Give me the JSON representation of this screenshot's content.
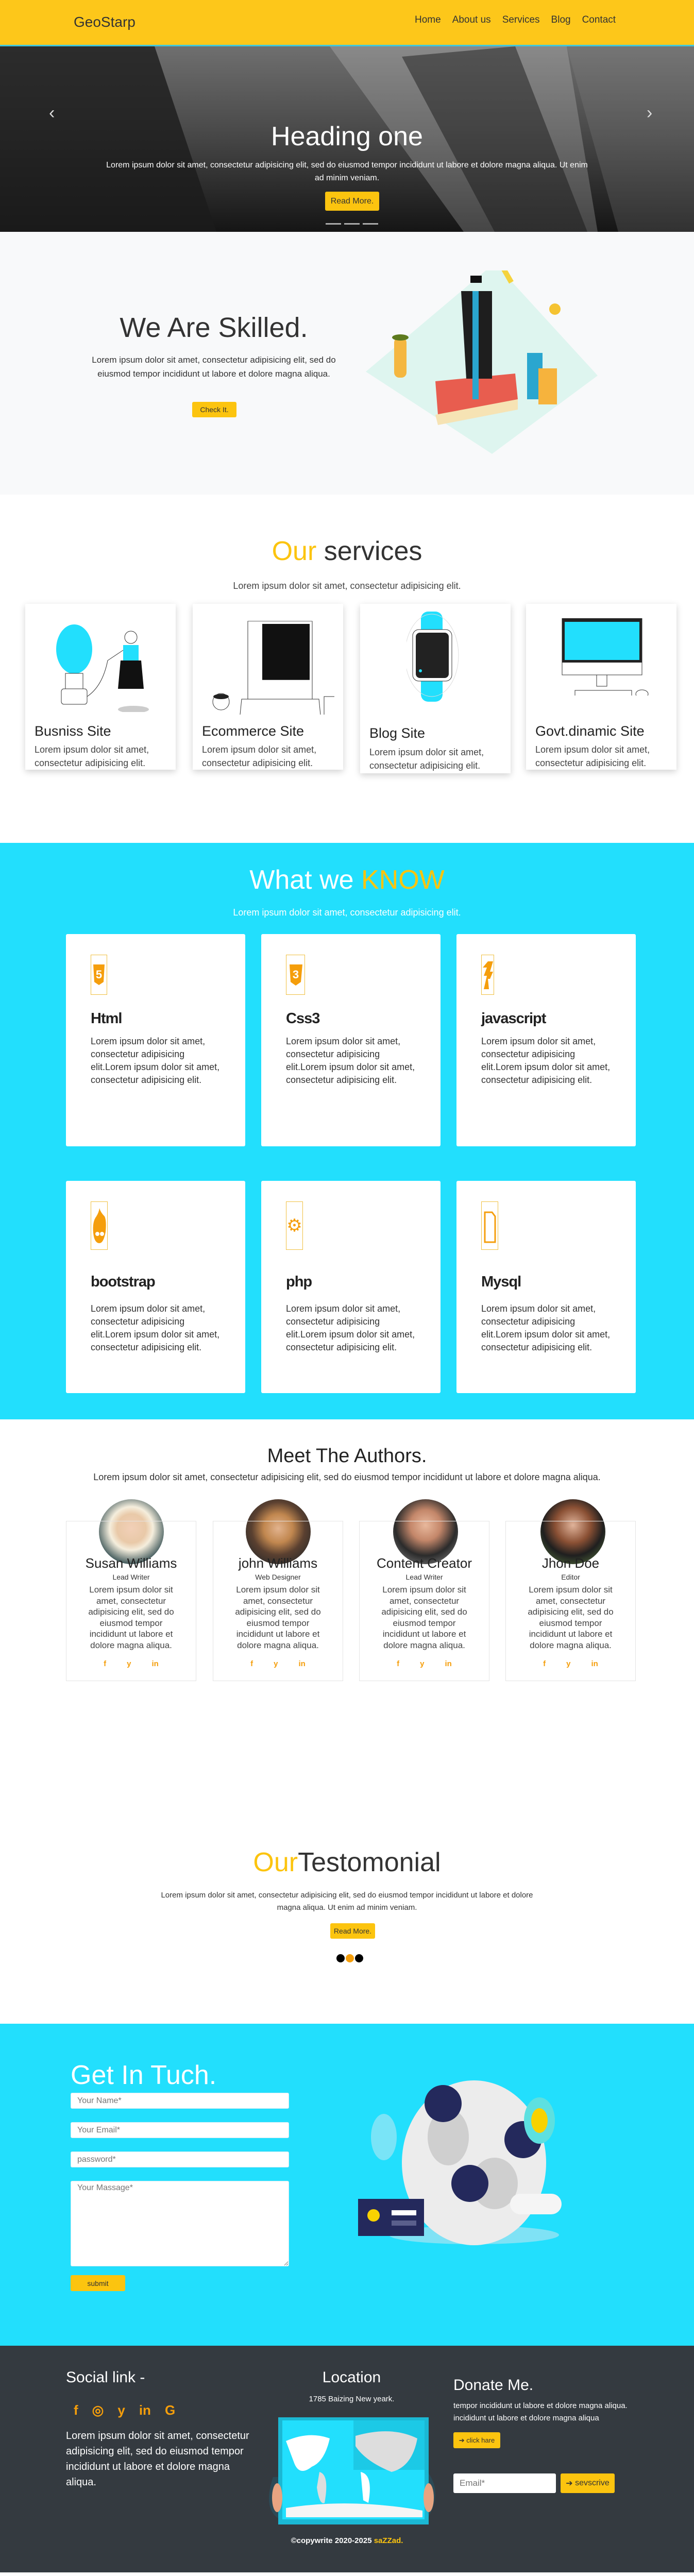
{
  "nav": {
    "logo": "GeoStarp",
    "items": [
      "Home",
      "About us",
      "Services",
      "Blog",
      "Contact"
    ]
  },
  "hero": {
    "heading": "Heading one",
    "text": "Lorem ipsum dolor sit amet, consectetur adipisicing elit, sed do eiusmod tempor incididunt ut labore et dolore magna aliqua. Ut enim ad minim veniam.",
    "button": "Read More.",
    "prev_icon": "chevron-left-icon",
    "next_icon": "chevron-right-icon"
  },
  "skilled": {
    "heading": "We Are Skilled.",
    "text": "Lorem ipsum dolor sit amet, consectetur adipisicing elit, sed do eiusmod tempor incididunt ut labore et dolore magna aliqua.",
    "button": "Check It."
  },
  "services": {
    "title_accent": "Our",
    "title_rest": " services",
    "subtitle": "Lorem ipsum dolor sit amet, consectetur adipisicing elit.",
    "cards": [
      {
        "title": "Busniss Site",
        "text": "Lorem ipsum dolor sit amet, consectetur adipisicing elit."
      },
      {
        "title": "Ecommerce Site",
        "text": "Lorem ipsum dolor sit amet, consectetur adipisicing elit."
      },
      {
        "title": "Blog Site",
        "text": "Lorem ipsum dolor sit amet, consectetur adipisicing elit."
      },
      {
        "title": "Govt.dinamic Site",
        "text": "Lorem ipsum dolor sit amet, consectetur adipisicing elit."
      }
    ]
  },
  "know": {
    "title_main": "What we ",
    "title_accent": "KNOW",
    "subtitle": "Lorem ipsum dolor sit amet, consectetur adipisicing elit.",
    "cards": [
      {
        "title": "Html",
        "icon": "html5-icon",
        "text": "Lorem ipsum dolor sit amet, consectetur adipisicing elit.Lorem ipsum dolor sit amet, consectetur adipisicing elit."
      },
      {
        "title": "Css3",
        "icon": "css3-icon",
        "text": "Lorem ipsum dolor sit amet, consectetur adipisicing elit.Lorem ipsum dolor sit amet, consectetur adipisicing elit."
      },
      {
        "title": "javascript",
        "icon": "javascript-icon",
        "text": "Lorem ipsum dolor sit amet, consectetur adipisicing elit.Lorem ipsum dolor sit amet, consectetur adipisicing elit."
      },
      {
        "title": "bootstrap",
        "icon": "drupal-icon",
        "text": "Lorem ipsum dolor sit amet, consectetur adipisicing elit.Lorem ipsum dolor sit amet, consectetur adipisicing elit."
      },
      {
        "title": "php",
        "icon": "gear-icon",
        "text": "Lorem ipsum dolor sit amet, consectetur adipisicing elit.Lorem ipsum dolor sit amet, consectetur adipisicing elit."
      },
      {
        "title": "Mysql",
        "icon": "file-icon",
        "text": "Lorem ipsum dolor sit amet, consectetur adipisicing elit.Lorem ipsum dolor sit amet, consectetur adipisicing elit."
      }
    ]
  },
  "authors": {
    "title": "Meet The Authors.",
    "subtitle": "Lorem ipsum dolor sit amet, consectetur adipisicing elit, sed do eiusmod tempor incididunt ut labore et dolore magna aliqua.",
    "social": [
      "f",
      "y",
      "in"
    ],
    "cards": [
      {
        "name": "Susan Williams",
        "role": "Lead Writer",
        "text": "Lorem ipsum dolor sit amet, consectetur adipisicing elit, sed do eiusmod tempor incididunt ut labore et dolore magna aliqua."
      },
      {
        "name": "john Williams",
        "role": "Web Designer",
        "text": "Lorem ipsum dolor sit amet, consectetur adipisicing elit, sed do eiusmod tempor incididunt ut labore et dolore magna aliqua."
      },
      {
        "name": "Content Creator",
        "role": "Lead Writer",
        "text": "Lorem ipsum dolor sit amet, consectetur adipisicing elit, sed do eiusmod tempor incididunt ut labore et dolore magna aliqua."
      },
      {
        "name": "Jhon Doe",
        "role": "Editor",
        "text": "Lorem ipsum dolor sit amet, consectetur adipisicing elit, sed do eiusmod tempor incididunt ut labore et dolore magna aliqua."
      }
    ]
  },
  "testimonial": {
    "title_accent": "Our",
    "title_rest": "Testomonial",
    "text": "Lorem ipsum dolor sit amet, consectetur adipisicing elit, sed do eiusmod tempor incididunt ut labore et dolore magna aliqua. Ut enim ad minim veniam.",
    "button": "Read More.",
    "active_dot": 1
  },
  "contact": {
    "title": "Get In Tuch.",
    "name_placeholder": "Your Name*",
    "email_placeholder": "Your Email*",
    "password_placeholder": "password*",
    "message_placeholder": "Your Massage*",
    "submit": "submit"
  },
  "footer": {
    "social_title": "Social link -",
    "social_icons": [
      "f",
      "◎",
      "y",
      "in",
      "G"
    ],
    "social_text": "Lorem ipsum dolor sit amet, consectetur adipisicing elit, sed do eiusmod tempor incididunt ut labore et dolore magna aliqua.",
    "location_title": "Location",
    "address": "1785 Baizing New yeark.",
    "donate_title": "Donate Me.",
    "donate_text": "tempor incididunt ut labore et dolore magna aliqua. incididunt ut labore et dolore magna aliqua",
    "donate_button": "click hare",
    "email_placeholder": "Email*",
    "subscribe_button": "sevscrive",
    "copyright": "©copywrite 2020-2025 ",
    "copyright_name": "saZZad."
  },
  "colors": {
    "yellow": "#fcc40f",
    "cyan": "#22dffd",
    "dark": "#343a40",
    "orange": "#f59e0b"
  }
}
